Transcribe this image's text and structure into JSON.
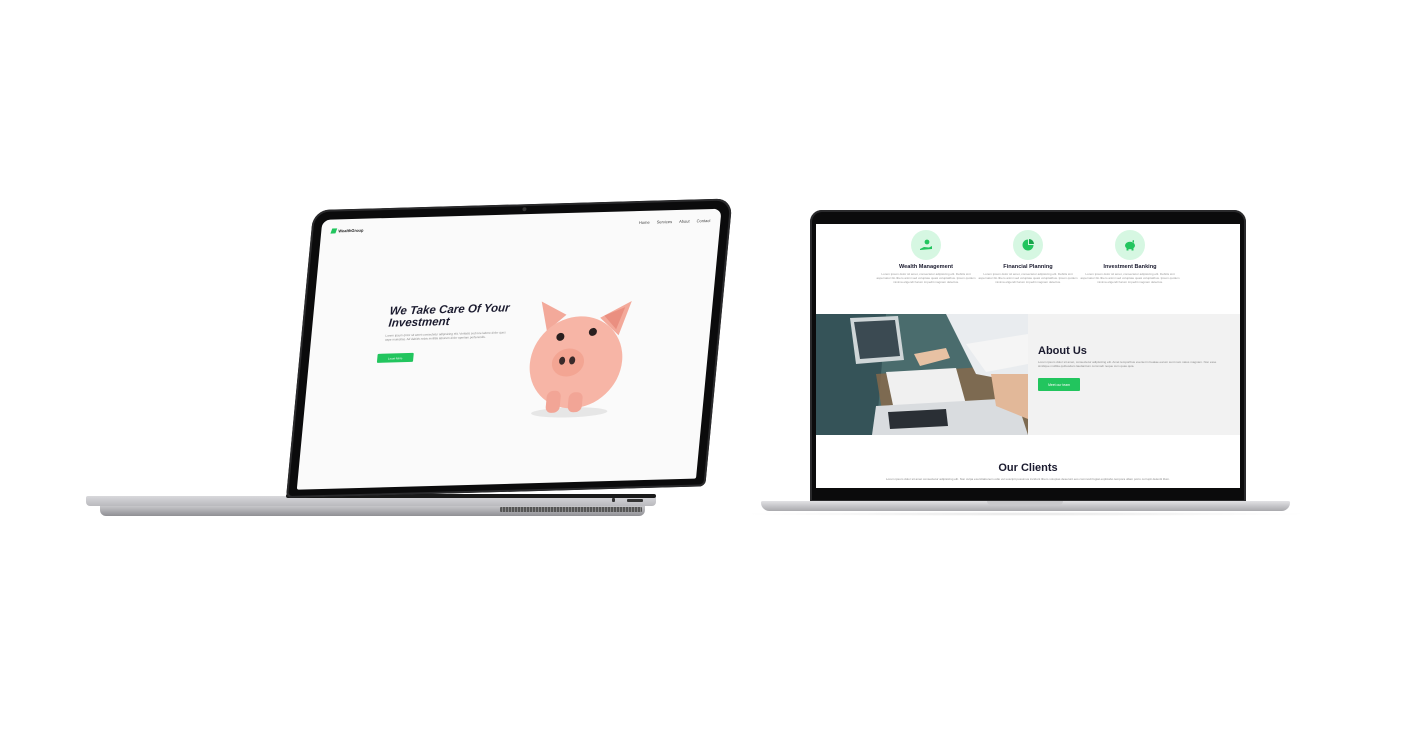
{
  "left_site": {
    "brand": "WealthGroup",
    "nav": [
      "Home",
      "Services",
      "About",
      "Contact"
    ],
    "hero_title": "We Take Care Of Your Investment",
    "hero_text": "Lorem ipsum dolor sit amet consectetur adipisicing elit. Veritatis sed iure labore dolor quos aspe molestias. Ad debitis nobis mollitia laborum dolor aperiam perferendis.",
    "cta": "Learn More"
  },
  "right_site": {
    "services": [
      {
        "icon": "hand-coin-icon",
        "title": "Wealth Management",
        "text": "Lorem ipsum dolor sit amet, consectetur adipisicing elit. Debitis sint aspernatur illo libero animi sed voluptate quasi voluptatibus. Ipsum quidem minima eligendi harum impedit magnam delectus."
      },
      {
        "icon": "pie-chart-icon",
        "title": "Financial Planning",
        "text": "Lorem ipsum dolor sit amet, consectetur adipisicing elit. Debitis sint aspernatur illo libero animi sed voluptate quasi voluptatibus. Ipsum quidem minima eligendi harum impedit magnam delectus."
      },
      {
        "icon": "piggy-bank-icon",
        "title": "Investment Banking",
        "text": "Lorem ipsum dolor sit amet, consectetur adipisicing elit. Debitis sint aspernatur illo libero animi sed voluptate quasi voluptatibus. Ipsum quidem minima eligendi harum impedit magnam delectus."
      }
    ],
    "about_title": "About Us",
    "about_text": "Lorem ipsum dolor sit amet, consectetur adipisicing elit. Amet temporibus eveniet in beatae earum sunt nam natus magnam. Non esse similique mollitia quibusdam laudantium commodi neque cum quas quia.",
    "about_button": "Meet our team",
    "clients_title": "Our Clients",
    "clients_text": "Lorem ipsum dolor sit amet consectetur adipisicing elit. Non culpa exercitationem odio vel suscipit possimus incidunt libero voluptas deserunt eos commodi fugiat explicabo tempora ullam porro corrupti deleniti illum."
  },
  "colors": {
    "accent": "#22c55e",
    "accent_light": "#d6f7e2",
    "heading": "#1a1a2e"
  }
}
